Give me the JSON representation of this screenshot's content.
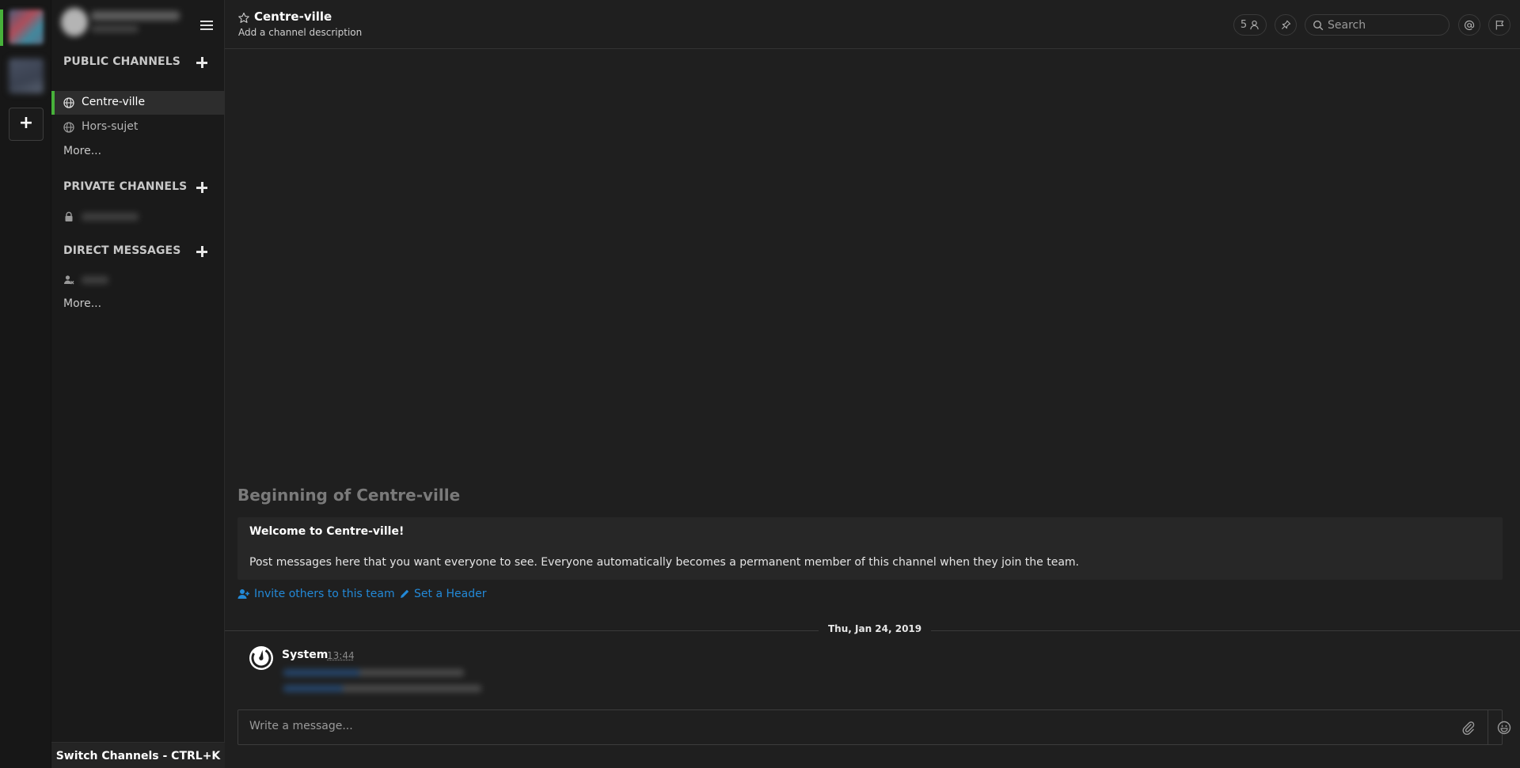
{
  "colors": {
    "accent_green": "#47b13a",
    "link_blue": "#2389d7",
    "sidebar_bg": "#1a1a1a",
    "main_bg": "#1f1f1f"
  },
  "team_sidebar": {
    "add_team_label": "+"
  },
  "sidebar": {
    "sections": {
      "public": {
        "title": "PUBLIC CHANNELS",
        "more": "More..."
      },
      "private": {
        "title": "PRIVATE CHANNELS"
      },
      "direct": {
        "title": "DIRECT MESSAGES",
        "more": "More..."
      }
    },
    "public_channels": [
      {
        "label": "Centre-ville",
        "icon": "globe-icon"
      },
      {
        "label": "Hors-sujet",
        "icon": "globe-icon"
      }
    ],
    "switch_channels": "Switch Channels - CTRL+K"
  },
  "header": {
    "channel_name": "Centre-ville",
    "channel_description": "Add a channel description",
    "member_count": "5",
    "search_placeholder": "Search"
  },
  "intro": {
    "title": "Beginning of Centre-ville",
    "welcome": "Welcome to Centre-ville!",
    "body": "Post messages here that you want everyone to see. Everyone automatically becomes a permanent member of this channel when they join the team.",
    "invite_link": "Invite others to this team",
    "header_link": "Set a Header"
  },
  "posts": {
    "date_separator": "Thu, Jan 24, 2019",
    "items": [
      {
        "user": "System",
        "time": "13:44"
      }
    ]
  },
  "composer": {
    "placeholder": "Write a message..."
  }
}
